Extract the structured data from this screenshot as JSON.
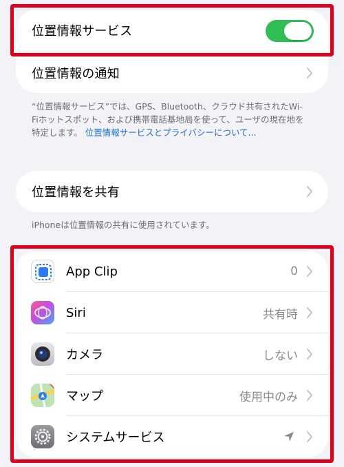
{
  "location_services": {
    "label": "位置情報サービス",
    "enabled": true
  },
  "location_alerts": {
    "label": "位置情報の通知"
  },
  "description": {
    "text": "“位置情報サービス”では、GPS、Bluetooth、クラウド共有されたWi-Fiホットスポット、および携帯電話基地局を使って、ユーザの現在地を特定します。",
    "link": "位置情報サービスとプライバシーについて..."
  },
  "share_location": {
    "label": "位置情報を共有"
  },
  "share_note": "iPhoneは位置情報の共有に使用されています。",
  "apps": [
    {
      "name": "App Clip",
      "value": "0",
      "icon": "app-clip-icon"
    },
    {
      "name": "Siri",
      "value": "共有時",
      "icon": "siri-icon"
    },
    {
      "name": "カメラ",
      "value": "しない",
      "icon": "camera-icon"
    },
    {
      "name": "マップ",
      "value": "使用中のみ",
      "icon": "maps-icon"
    },
    {
      "name": "システムサービス",
      "value": "",
      "icon": "system-services-gear-icon",
      "status_icon": "location-arrow-icon"
    }
  ],
  "colors": {
    "toggle_on": "#2fbe55",
    "highlight": "#e0001b",
    "link": "#1a6fd8",
    "background": "#f2f2f7"
  }
}
